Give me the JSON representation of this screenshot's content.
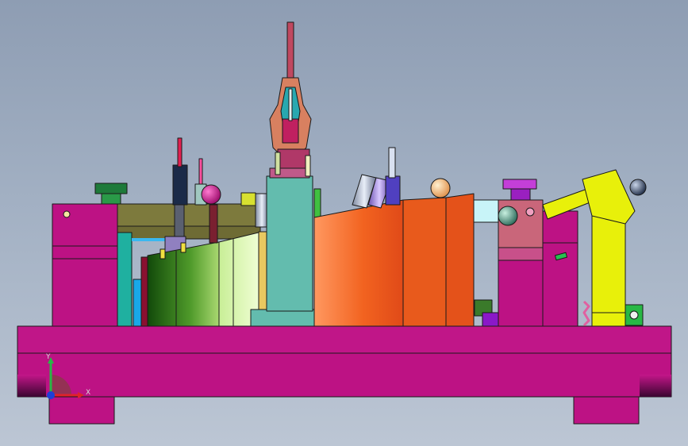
{
  "viewport": {
    "background_top": "#8e9db3",
    "background_bottom": "#bcc6d4"
  },
  "colors": {
    "base_magenta": "#bd1284",
    "base_outline": "#1a1a1a",
    "olive_bar": "#7d7a3d",
    "teal_column": "#63bcae",
    "orange_panel": "#f05a1c",
    "green_panel": "#2e7a1a",
    "yellow_arm": "#e8f00a",
    "pink_block": "#c9667a",
    "violet_knob": "#c43fd8"
  },
  "triad": {
    "x_label": "X",
    "y_label": "Y",
    "x_color": "#e0222a",
    "y_color": "#28b845",
    "z_color": "#1f3fd8"
  }
}
